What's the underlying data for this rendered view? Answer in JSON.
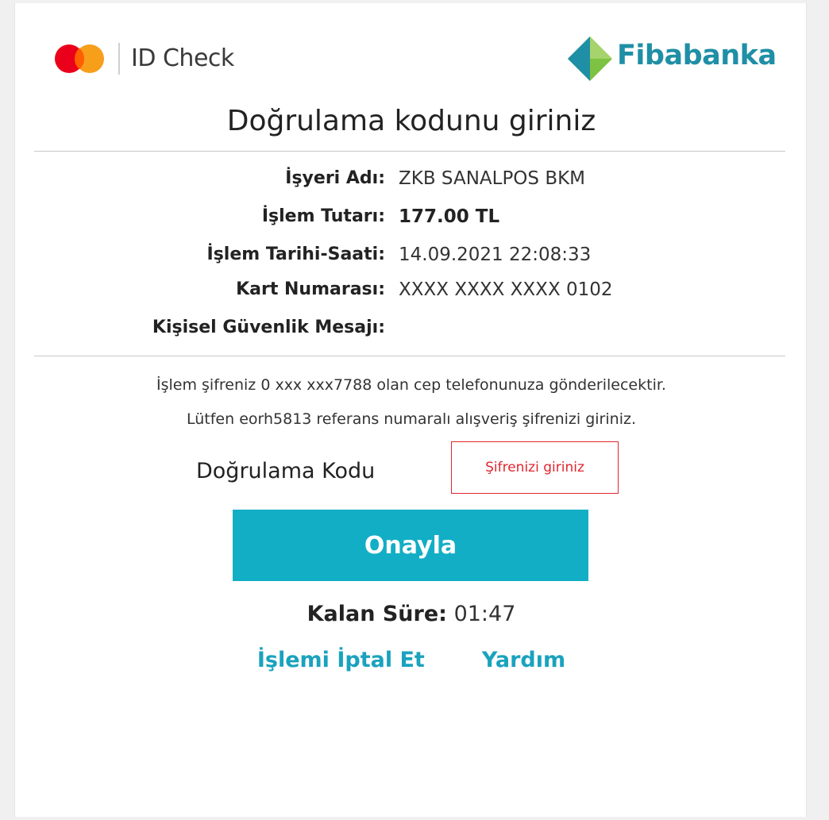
{
  "header": {
    "brand_left": "ID Check",
    "brand_right": "Fibabanka",
    "logo_left_icon": "mastercard-logo-icon",
    "logo_right_icon": "fibabanka-diamond-icon"
  },
  "title": "Doğrulama kodunu giriniz",
  "transaction": {
    "rows": [
      {
        "label": "İşyeri Adı:",
        "value": "ZKB SANALPOS BKM"
      },
      {
        "label": "İşlem Tutarı:",
        "value": "177.00 TL"
      },
      {
        "label": "İşlem Tarihi-Saati:",
        "value": "14.09.2021 22:08:33"
      },
      {
        "label": "Kart Numarası:",
        "value": "XXXX XXXX XXXX 0102"
      },
      {
        "label": "Kişisel Güvenlik Mesajı:",
        "value": ""
      }
    ]
  },
  "notes": {
    "line1": "İşlem şifreniz 0 xxx xxx7788 olan cep telefonunuza gönderilecektir.",
    "line2": "Lütfen eorh5813 referans numaralı alışveriş şifrenizi giriniz."
  },
  "form": {
    "code_label": "Doğrulama Kodu",
    "code_placeholder": "Şifrenizi giriniz",
    "code_value": "",
    "confirm_label": "Onayla"
  },
  "timer": {
    "label": "Kalan Süre:",
    "value": "01:47"
  },
  "links": {
    "cancel": "İşlemi İptal Et",
    "help": "Yardım"
  },
  "colors": {
    "accent": "#12aec5",
    "link": "#1aa2be",
    "error": "#e2262f",
    "brand": "#1f8fa6"
  }
}
